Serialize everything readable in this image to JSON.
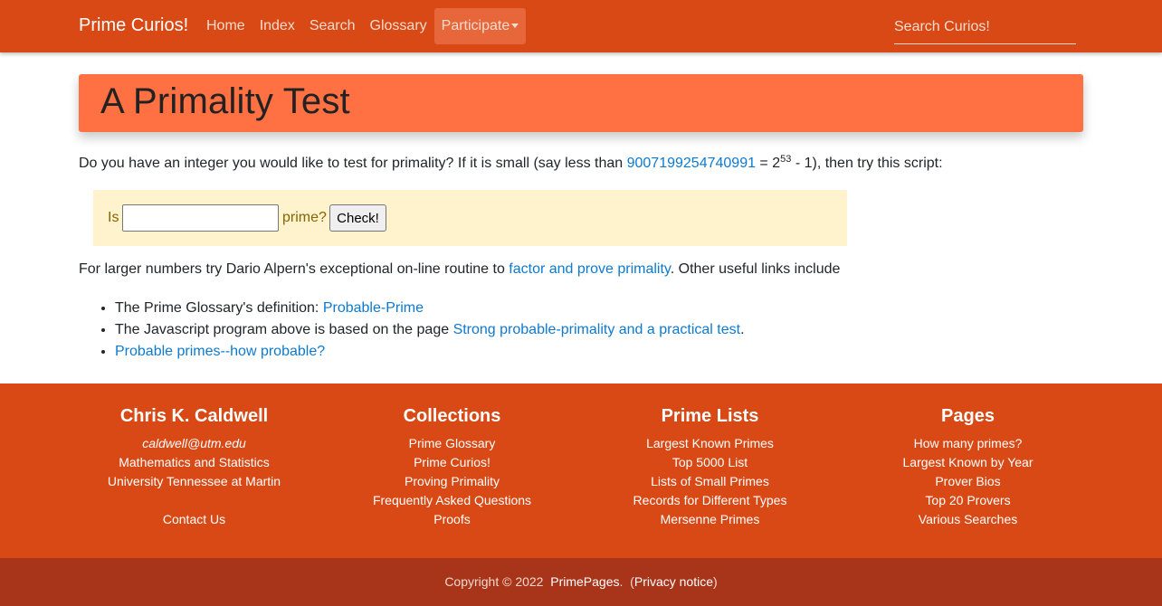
{
  "navbar": {
    "brand": "Prime Curios!",
    "items": [
      {
        "label": "Home"
      },
      {
        "label": "Index"
      },
      {
        "label": "Search"
      },
      {
        "label": "Glossary"
      },
      {
        "label": "Participate"
      }
    ],
    "search_placeholder": "Search Curios!"
  },
  "banner": {
    "title": "A Primality Test"
  },
  "intro": {
    "before": "Do you have an integer you would like to test for primality? If it is small (say less than ",
    "link": "9007199254740991",
    "eq": " = 2",
    "exp": "53",
    "after": " - 1), then try this script:"
  },
  "check": {
    "is_label": "Is",
    "prime_label": "prime?",
    "button": "Check!"
  },
  "larger": {
    "before": "For larger numbers try Dario Alpern's exceptional on-line routine to ",
    "link": "factor and prove primality",
    "after": ". Other useful links include"
  },
  "links": [
    {
      "text": "The Prime Glossary's definition: ",
      "link": "Probable-Prime",
      "after": ""
    },
    {
      "text": "The Javascript program above is based on the page ",
      "link": "Strong probable-primality and a practical test",
      "after": "."
    },
    {
      "text": "",
      "link": "Probable primes--how probable?",
      "after": ""
    }
  ],
  "footer": {
    "author": {
      "title": "Chris K. Caldwell",
      "email": "caldwell@utm.edu",
      "dept": "Mathematics and Statistics",
      "univ": "University Tennessee at Martin",
      "contact": "Contact Us"
    },
    "collections": {
      "title": "Collections",
      "items": [
        "Prime Glossary",
        "Prime Curios!",
        "Proving Primality",
        "Frequently Asked Questions",
        "Proofs"
      ]
    },
    "prime_lists": {
      "title": "Prime Lists",
      "items": [
        "Largest Known Primes",
        "Top 5000 List",
        "Lists of Small Primes",
        "Records for Different Types",
        "Mersenne Primes"
      ]
    },
    "pages": {
      "title": "Pages",
      "items": [
        "How many primes?",
        "Largest Known by Year",
        "Prover Bios",
        "Top 20 Provers",
        "Various Searches"
      ]
    }
  },
  "copyright": {
    "text": "Copyright © 2022",
    "site": "PrimePages",
    "privacy": "Privacy notice"
  },
  "colors": {
    "navbar": "#d84915",
    "banner": "#ff7043",
    "alert": "#fff3cd",
    "copyright_bar": "#a8341a",
    "link": "#0d7ad0"
  }
}
